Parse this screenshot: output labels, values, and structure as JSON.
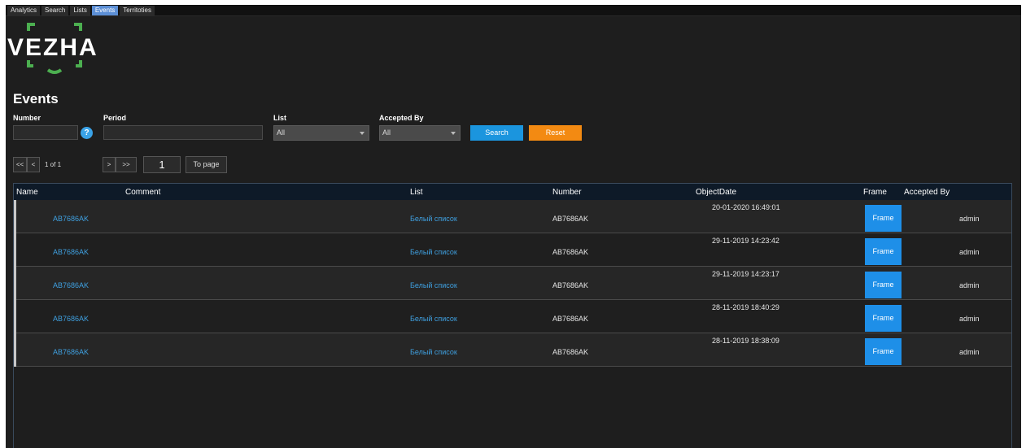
{
  "nav": {
    "tabs": [
      {
        "label": "Analytics"
      },
      {
        "label": "Search"
      },
      {
        "label": "Lists"
      },
      {
        "label": "Events",
        "active": true
      },
      {
        "label": "Territoties"
      }
    ]
  },
  "logo": {
    "text": "VEZHA",
    "accent_color": "#4caf50"
  },
  "page": {
    "title": "Events"
  },
  "filters": {
    "number_label": "Number",
    "number_value": "",
    "period_label": "Period",
    "period_value": "",
    "list_label": "List",
    "list_value": "All",
    "accepted_label": "Accepted By",
    "accepted_value": "All",
    "search_label": "Search",
    "reset_label": "Reset"
  },
  "pager": {
    "first": "<<",
    "prev": "<",
    "status": "1 of 1",
    "next": ">",
    "last": ">>",
    "page_value": "1",
    "to_page_label": "To page"
  },
  "table": {
    "headers": {
      "name": "Name",
      "comment": "Comment",
      "list": "List",
      "number": "Number",
      "object_date": "ObjectDate",
      "frame": "Frame",
      "accepted_by": "Accepted By"
    },
    "rows": [
      {
        "name": "AB7686AK",
        "comment": "",
        "list": "Белый список",
        "number": "AB7686AK",
        "date": "20-01-2020 16:49:01",
        "frame": "Frame",
        "accepted_by": "admin"
      },
      {
        "name": "AB7686AK",
        "comment": "",
        "list": "Белый список",
        "number": "AB7686AK",
        "date": "29-11-2019 14:23:42",
        "frame": "Frame",
        "accepted_by": "admin"
      },
      {
        "name": "AB7686AK",
        "comment": "",
        "list": "Белый список",
        "number": "AB7686AK",
        "date": "29-11-2019 14:23:17",
        "frame": "Frame",
        "accepted_by": "admin"
      },
      {
        "name": "AB7686AK",
        "comment": "",
        "list": "Белый список",
        "number": "AB7686AK",
        "date": "28-11-2019 18:40:29",
        "frame": "Frame",
        "accepted_by": "admin"
      },
      {
        "name": "AB7686AK",
        "comment": "",
        "list": "Белый список",
        "number": "AB7686AK",
        "date": "28-11-2019 18:38:09",
        "frame": "Frame",
        "accepted_by": "admin"
      }
    ]
  },
  "colors": {
    "background": "#1e1e1e",
    "link": "#3fa0e0",
    "search_button": "#1b95de",
    "reset_button": "#f38a12",
    "frame_button": "#1e8fe8",
    "active_tab": "#5c8fd6"
  }
}
